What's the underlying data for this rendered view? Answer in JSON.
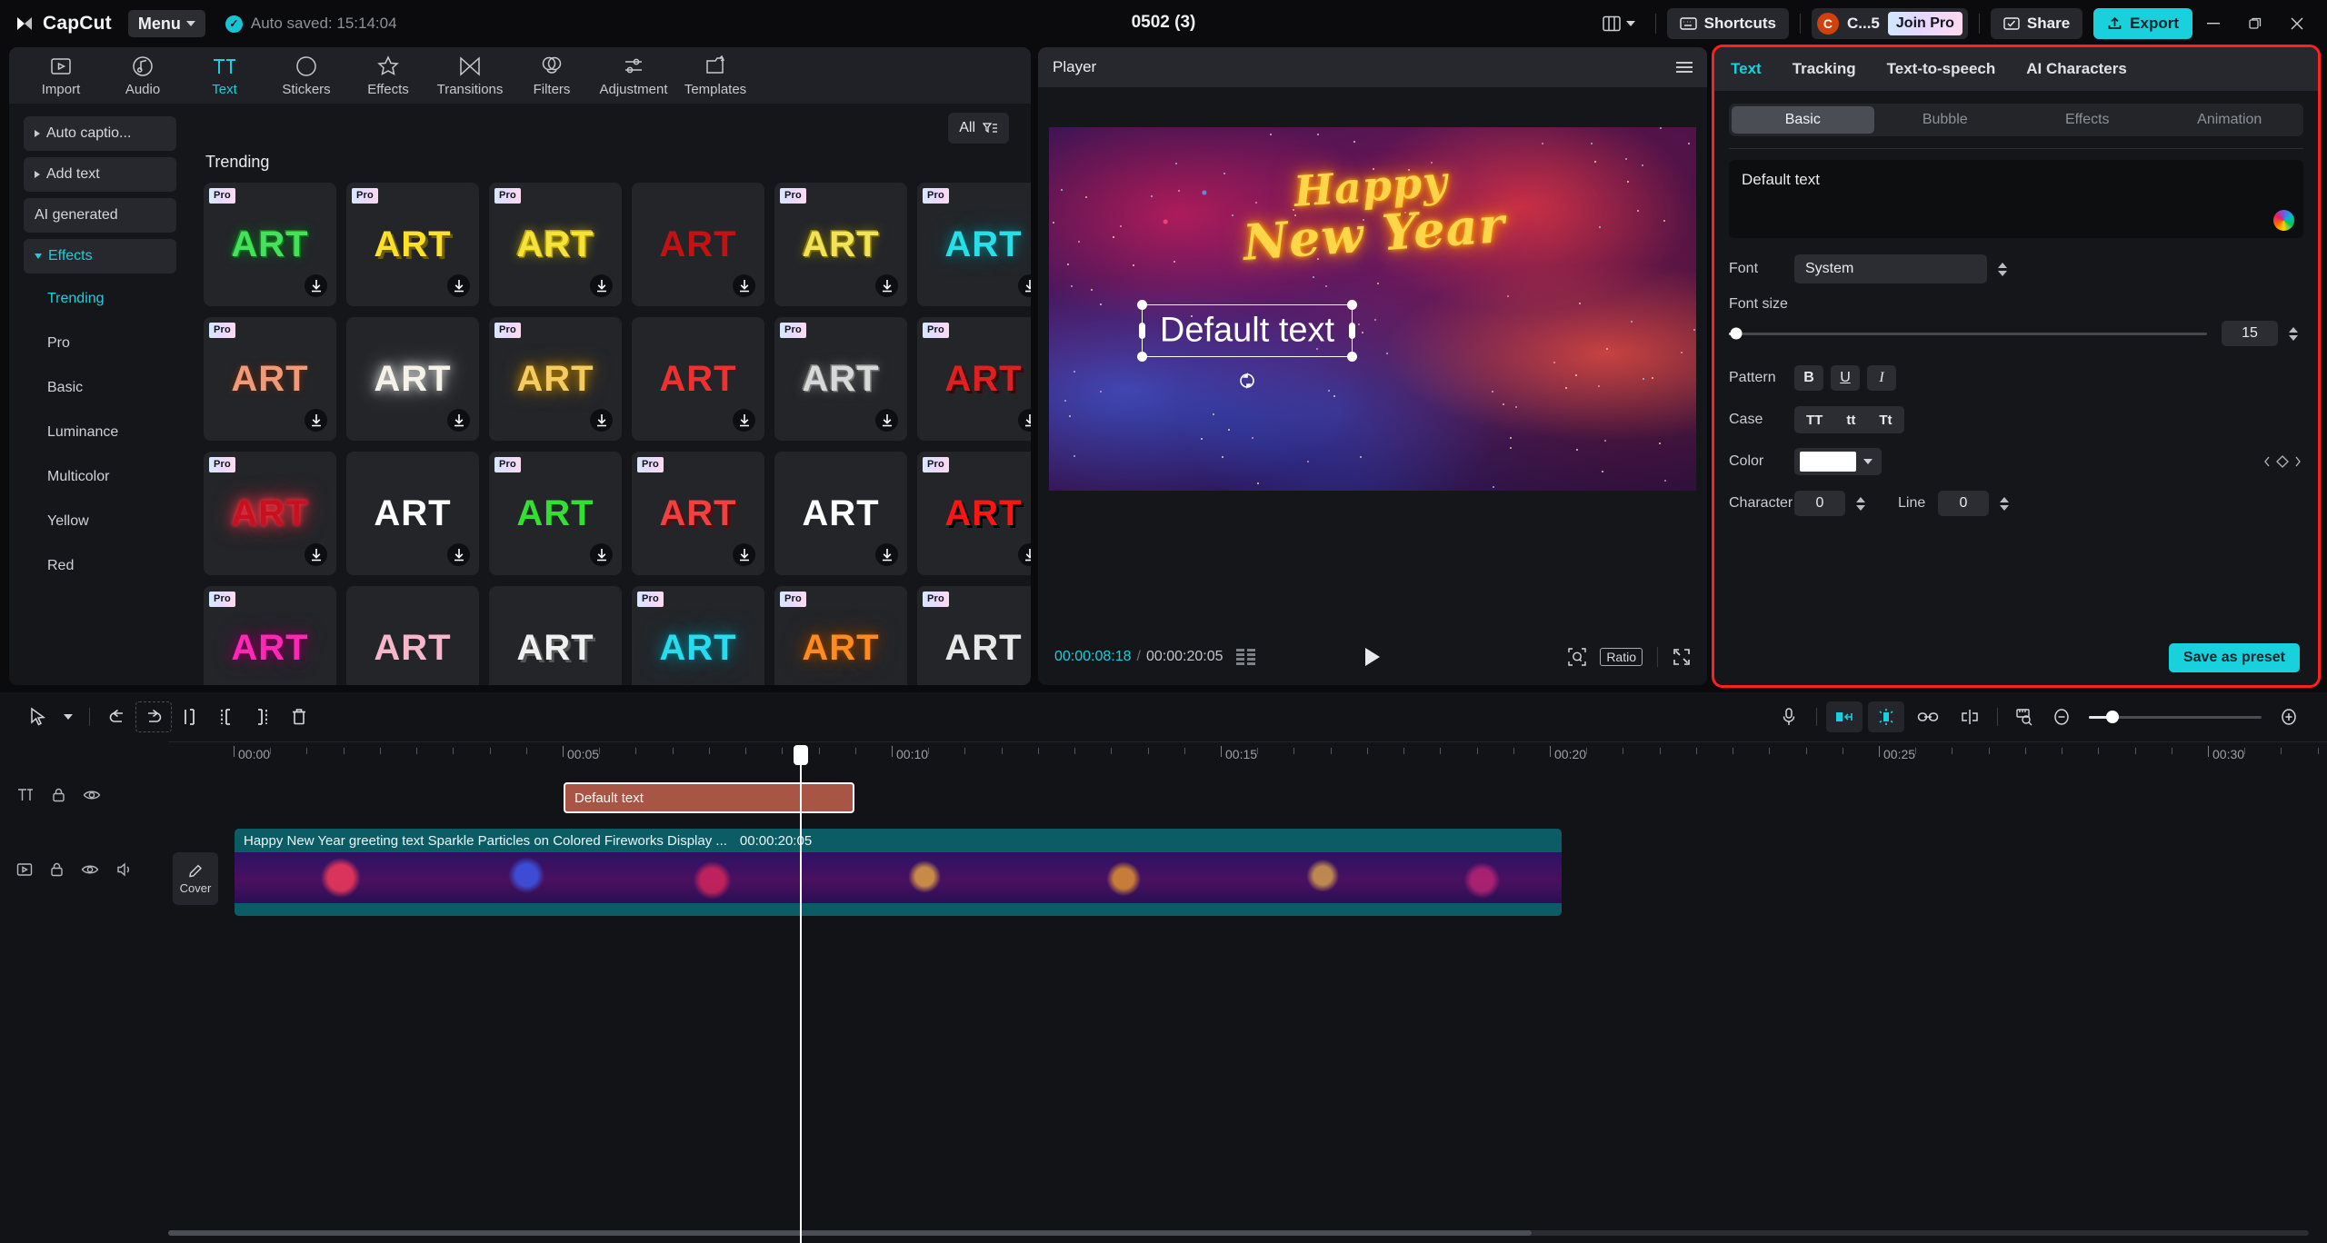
{
  "titlebar": {
    "brand": "CapCut",
    "menu_label": "Menu",
    "autosave": "Auto saved: 15:14:04",
    "project_title": "0502 (3)",
    "shortcuts_label": "Shortcuts",
    "account_name": "C...5",
    "account_initial": "C",
    "join_pro_label": "Join Pro",
    "share_label": "Share",
    "export_label": "Export",
    "minimize": "–",
    "maximize": "❐",
    "close": "✕"
  },
  "toolbar_tabs": [
    {
      "label": "Import",
      "icon": "import-icon",
      "active": false
    },
    {
      "label": "Audio",
      "icon": "audio-icon",
      "active": false
    },
    {
      "label": "Text",
      "icon": "text-icon",
      "active": true
    },
    {
      "label": "Stickers",
      "icon": "stickers-icon",
      "active": false
    },
    {
      "label": "Effects",
      "icon": "effects-icon",
      "active": false
    },
    {
      "label": "Transitions",
      "icon": "transitions-icon",
      "active": false
    },
    {
      "label": "Filters",
      "icon": "filters-icon",
      "active": false
    },
    {
      "label": "Adjustment",
      "icon": "adjustment-icon",
      "active": false
    },
    {
      "label": "Templates",
      "icon": "templates-icon",
      "active": false
    }
  ],
  "nav": {
    "buttons": [
      {
        "label": "Auto captio...",
        "expandable": true,
        "expanded": false,
        "active": false
      },
      {
        "label": "Add text",
        "expandable": true,
        "expanded": false,
        "active": false
      },
      {
        "label": "AI generated",
        "expandable": false,
        "expanded": false,
        "active": false
      },
      {
        "label": "Effects",
        "expandable": true,
        "expanded": true,
        "active": true
      }
    ],
    "subitems": [
      {
        "label": "Trending",
        "active": true
      },
      {
        "label": "Pro",
        "active": false
      },
      {
        "label": "Basic",
        "active": false
      },
      {
        "label": "Luminance",
        "active": false
      },
      {
        "label": "Multicolor",
        "active": false
      },
      {
        "label": "Yellow",
        "active": false
      },
      {
        "label": "Red",
        "active": false
      }
    ]
  },
  "library": {
    "filter_label": "All",
    "section_title": "Trending",
    "pro_badge": "Pro",
    "tile_word": "ART",
    "tiles": [
      {
        "color": "#46e05c",
        "glow": "#0d7a1d",
        "pro": true,
        "dl": true,
        "bg": "#232529",
        "style": "outline"
      },
      {
        "color": "#ffe028",
        "glow": "#6b5a00",
        "pro": true,
        "dl": true,
        "bg": "#232529",
        "style": "shadow"
      },
      {
        "color": "#f5e23c",
        "glow": "#b9a400",
        "pro": true,
        "dl": true,
        "bg": "#232529",
        "style": "outline"
      },
      {
        "color": "#c41212",
        "glow": "#4a0404",
        "pro": false,
        "dl": true,
        "bg": "#232529",
        "style": "flat"
      },
      {
        "color": "#f2e25a",
        "glow": "#8a7a00",
        "pro": true,
        "dl": true,
        "bg": "#232529",
        "style": "outline"
      },
      {
        "color": "#25e0e8",
        "glow": "#0a6b70",
        "pro": true,
        "dl": true,
        "bg": "#232529",
        "style": "glow"
      },
      {
        "color": "#f09a7a",
        "glow": "#6b2a12",
        "pro": true,
        "dl": true,
        "bg": "#232529",
        "style": "speckle"
      },
      {
        "color": "#f6f2e8",
        "glow": "#cccccc",
        "pro": false,
        "dl": true,
        "bg": "#232529",
        "style": "glow"
      },
      {
        "color": "#f3cb5e",
        "glow": "#b37d00",
        "pro": true,
        "dl": true,
        "bg": "#232529",
        "style": "glow"
      },
      {
        "color": "#f03030",
        "glow": "#5a0808",
        "pro": false,
        "dl": true,
        "bg": "#232529",
        "style": "flat"
      },
      {
        "color": "#d8d8d8",
        "glow": "#777777",
        "pro": true,
        "dl": true,
        "bg": "#232529",
        "style": "outline"
      },
      {
        "color": "#e02020",
        "glow": "#400404",
        "pro": true,
        "dl": true,
        "bg": "#232529",
        "style": "shadow"
      },
      {
        "color": "#c81020",
        "glow": "#ff3344",
        "pro": true,
        "dl": true,
        "bg": "#232529",
        "style": "neon"
      },
      {
        "color": "#ffffff",
        "glow": "#aaaaaa",
        "pro": false,
        "dl": true,
        "bg": "#232529",
        "style": "flat"
      },
      {
        "color": "#32e032",
        "glow": "#0b6b0b",
        "pro": true,
        "dl": true,
        "bg": "#232529",
        "style": "flat"
      },
      {
        "color": "#f04040",
        "glow": "#5a0c0c",
        "pro": true,
        "dl": true,
        "bg": "#232529",
        "style": "shadow"
      },
      {
        "color": "#ffffff",
        "glow": "#888888",
        "pro": false,
        "dl": true,
        "bg": "#232529",
        "style": "flat"
      },
      {
        "color": "#ff1414",
        "glow": "#000000",
        "pro": true,
        "dl": true,
        "bg": "#232529",
        "style": "shadow"
      },
      {
        "color": "#ff28b4",
        "glow": "#7a0055",
        "pro": true,
        "dl": false,
        "bg": "#232529",
        "style": "glow"
      },
      {
        "color": "#f6b8c8",
        "glow": "#8a4a5a",
        "pro": false,
        "dl": false,
        "bg": "#232529",
        "style": "flat"
      },
      {
        "color": "#f0f0f0",
        "glow": "#555555",
        "pro": false,
        "dl": false,
        "bg": "#232529",
        "style": "shadow"
      },
      {
        "color": "#28dcf0",
        "glow": "#0a6b78",
        "pro": true,
        "dl": false,
        "bg": "#232529",
        "style": "neon"
      },
      {
        "color": "#ff8a1e",
        "glow": "#7a3c00",
        "pro": true,
        "dl": false,
        "bg": "#232529",
        "style": "neon"
      },
      {
        "color": "#e8e8e8",
        "glow": "#666666",
        "pro": true,
        "dl": false,
        "bg": "#232529",
        "style": "flat"
      }
    ]
  },
  "player": {
    "panel_title": "Player",
    "preview_headline_line1": "Happy",
    "preview_headline_line2": "New Year",
    "overlay_text": "Default text",
    "current_time": "00:00:08:18",
    "time_separator": "/",
    "total_time": "00:00:20:05",
    "ratio_label": "Ratio"
  },
  "properties": {
    "tabs": [
      {
        "label": "Text",
        "active": true
      },
      {
        "label": "Tracking",
        "active": false
      },
      {
        "label": "Text-to-speech",
        "active": false
      },
      {
        "label": "AI Characters",
        "active": false
      }
    ],
    "segments": [
      {
        "label": "Basic",
        "active": true
      },
      {
        "label": "Bubble",
        "active": false
      },
      {
        "label": "Effects",
        "active": false
      },
      {
        "label": "Animation",
        "active": false
      }
    ],
    "text_value": "Default text",
    "font_label": "Font",
    "font_value": "System",
    "font_size_label": "Font size",
    "font_size_value": "15",
    "pattern_label": "Pattern",
    "pattern_buttons": [
      "B",
      "U",
      "I"
    ],
    "case_label": "Case",
    "case_buttons": [
      "TT",
      "tt",
      "Tt"
    ],
    "color_label": "Color",
    "color_value": "#ffffff",
    "character_label": "Character",
    "character_value": "0",
    "line_label": "Line",
    "line_value": "0",
    "save_preset_label": "Save as preset"
  },
  "timeline": {
    "ruler_labels": [
      "00:00",
      "00:05",
      "00:10",
      "00:15",
      "00:20",
      "00:25",
      "00:30"
    ],
    "text_clip_label": "Default text",
    "video_clip_label": "Happy New Year greeting text Sparkle Particles on Colored Fireworks Display ...",
    "video_clip_duration": "00:00:20:05",
    "cover_label": "Cover",
    "tools_left": [
      "select-tool",
      "dropdown-tool",
      "undo-tool",
      "redo-tool",
      "split-tool",
      "trim-left-tool",
      "trim-right-tool",
      "delete-tool"
    ],
    "tools_right": [
      "mic-icon",
      "fit-to-screen-icon",
      "snap-icon",
      "link-icon",
      "mirror-icon",
      "ruler-icon",
      "zoom-out-icon",
      "zoom-in-icon"
    ]
  }
}
